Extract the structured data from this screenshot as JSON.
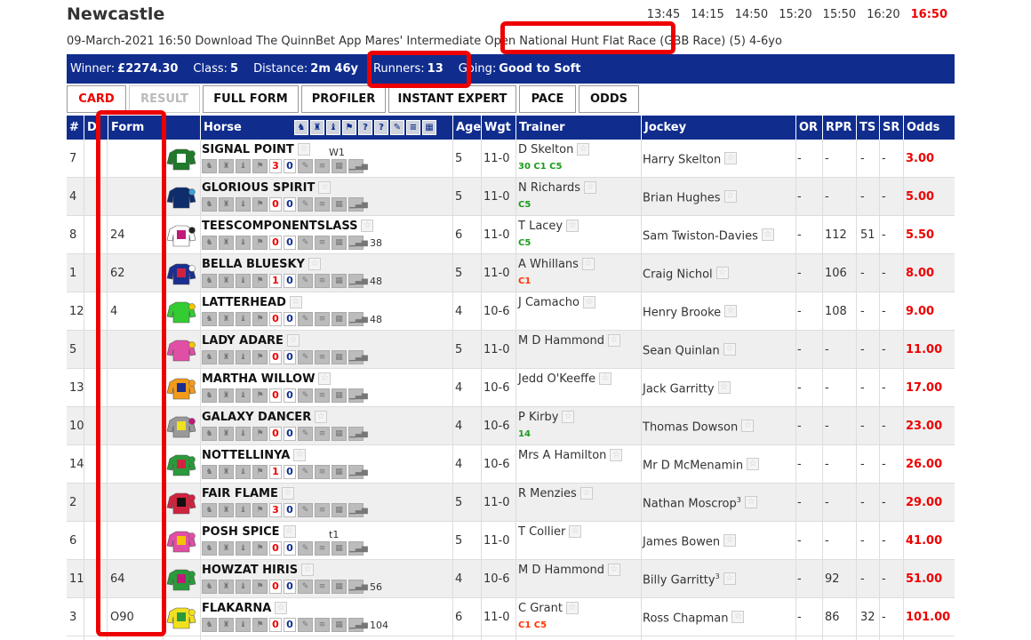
{
  "header": {
    "venue": "Newcastle",
    "times": [
      "13:45",
      "14:15",
      "14:50",
      "15:20",
      "15:50",
      "16:20",
      "16:50"
    ],
    "current_time": "16:50",
    "description": "09-March-2021 16:50 Download The QuinnBet App Mares' Intermediate Open National Hunt Flat Race (GBB Race) (5) 4-6yo"
  },
  "info": {
    "winner_label": "Winner:",
    "winner": "£2274.30",
    "class_label": "Class:",
    "class": "5",
    "distance_label": "Distance:",
    "distance": "2m 46y",
    "runners_label": "Runners:",
    "runners": "13",
    "going_label": "Going:",
    "going": "Good to Soft"
  },
  "tabs": [
    "CARD",
    "RESULT",
    "FULL FORM",
    "PROFILER",
    "INSTANT EXPERT",
    "PACE",
    "ODDS"
  ],
  "columns": {
    "num": "#",
    "draw": "D",
    "form": "Form",
    "horse": "Horse",
    "age": "Age",
    "wgt": "Wgt",
    "trainer": "Trainer",
    "jockey": "Jockey",
    "or": "OR",
    "rpr": "RPR",
    "ts": "TS",
    "sr": "SR",
    "odds": "Odds"
  },
  "header_icon_q": "?",
  "colors": {
    "bar": "#102d8e",
    "highlight": "#e00000",
    "odds": "#e00000"
  },
  "runners": [
    {
      "num": "7",
      "form": "",
      "horse": "SIGNAL POINT",
      "note": "W1",
      "b1": "3",
      "b2": "0",
      "rating": "",
      "age": "5",
      "wgt": "11-0",
      "trainer": "D Skelton",
      "tstat": "30 C1 C5",
      "tcolor": "green",
      "jockey": "Harry Skelton",
      "jsup": "",
      "or": "-",
      "rpr": "-",
      "ts": "-",
      "sr": "-",
      "odds": "3.00",
      "silk": [
        "#1f7a2a",
        "#ffffff",
        "#1f7a2a"
      ]
    },
    {
      "num": "4",
      "form": "",
      "horse": "GLORIOUS SPIRIT",
      "note": "",
      "b1": "0",
      "b2": "0",
      "rating": "",
      "age": "5",
      "wgt": "11-0",
      "trainer": "N Richards",
      "tstat": "C5",
      "tcolor": "green",
      "jockey": "Brian Hughes",
      "jsup": "",
      "or": "-",
      "rpr": "-",
      "ts": "-",
      "sr": "-",
      "odds": "5.00",
      "silk": [
        "#0d2d6b",
        "#0d2d6b",
        "#3aa0d8"
      ]
    },
    {
      "num": "8",
      "form": "24",
      "horse": "TEESCOMPONENTSLASS",
      "note": "",
      "b1": "0",
      "b2": "0",
      "rating": "38",
      "age": "6",
      "wgt": "11-0",
      "trainer": "T Lacey",
      "tstat": "C5",
      "tcolor": "green",
      "jockey": "Sam Twiston-Davies",
      "jsup": "",
      "or": "-",
      "rpr": "112",
      "ts": "51",
      "sr": "-",
      "odds": "5.50",
      "silk": [
        "#ffffff",
        "#c2187a",
        "#222222"
      ]
    },
    {
      "num": "1",
      "form": "62",
      "horse": "BELLA BLUESKY",
      "note": "",
      "b1": "1",
      "b2": "0",
      "rating": "48",
      "age": "5",
      "wgt": "11-0",
      "trainer": "A Whillans",
      "tstat": "C1",
      "tcolor": "red",
      "jockey": "Craig Nichol",
      "jsup": "",
      "or": "-",
      "rpr": "106",
      "ts": "-",
      "sr": "-",
      "odds": "8.00",
      "silk": [
        "#1a2f8f",
        "#d0233f",
        "#ffffff"
      ]
    },
    {
      "num": "12",
      "form": "4",
      "horse": "LATTERHEAD",
      "note": "",
      "b1": "0",
      "b2": "0",
      "rating": "48",
      "age": "4",
      "wgt": "10-6",
      "trainer": "J Camacho",
      "tstat": "",
      "tcolor": "green",
      "jockey": "Henry Brooke",
      "jsup": "",
      "or": "-",
      "rpr": "108",
      "ts": "-",
      "sr": "-",
      "odds": "9.00",
      "silk": [
        "#33cc33",
        "#33cc33",
        "#f2c500"
      ]
    },
    {
      "num": "5",
      "form": "",
      "horse": "LADY ADARE",
      "note": "",
      "b1": "0",
      "b2": "0",
      "rating": "",
      "age": "5",
      "wgt": "11-0",
      "trainer": "M D Hammond",
      "tstat": "",
      "tcolor": "green",
      "jockey": "Sean Quinlan",
      "jsup": "",
      "or": "-",
      "rpr": "-",
      "ts": "-",
      "sr": "-",
      "odds": "11.00",
      "silk": [
        "#e04fa5",
        "#e04fa5",
        "#f5c400"
      ]
    },
    {
      "num": "13",
      "form": "",
      "horse": "MARTHA WILLOW",
      "note": "",
      "b1": "0",
      "b2": "0",
      "rating": "",
      "age": "4",
      "wgt": "10-6",
      "trainer": "Jedd O'Keeffe",
      "tstat": "",
      "tcolor": "green",
      "jockey": "Jack Garritty",
      "jsup": "",
      "or": "-",
      "rpr": "-",
      "ts": "-",
      "sr": "-",
      "odds": "17.00",
      "silk": [
        "#f29a1a",
        "#1a2f8f",
        "#f29a1a"
      ]
    },
    {
      "num": "10",
      "form": "",
      "horse": "GALAXY DANCER",
      "note": "",
      "b1": "0",
      "b2": "0",
      "rating": "",
      "age": "4",
      "wgt": "10-6",
      "trainer": "P Kirby",
      "tstat": "14",
      "tcolor": "green",
      "jockey": "Thomas Dowson",
      "jsup": "",
      "or": "-",
      "rpr": "-",
      "ts": "-",
      "sr": "-",
      "odds": "23.00",
      "silk": [
        "#999999",
        "#f0e020",
        "#c2187a"
      ]
    },
    {
      "num": "14",
      "form": "",
      "horse": "NOTTELLINYA",
      "note": "",
      "b1": "1",
      "b2": "0",
      "rating": "",
      "age": "4",
      "wgt": "10-6",
      "trainer": "Mrs A Hamilton",
      "tstat": "",
      "tcolor": "green",
      "jockey": "Mr D McMenamin",
      "jsup": "",
      "or": "-",
      "rpr": "-",
      "ts": "-",
      "sr": "-",
      "odds": "26.00",
      "silk": [
        "#2a9a3a",
        "#d0233f",
        "#2a9a3a"
      ]
    },
    {
      "num": "2",
      "form": "",
      "horse": "FAIR FLAME",
      "note": "",
      "b1": "3",
      "b2": "0",
      "rating": "",
      "age": "5",
      "wgt": "11-0",
      "trainer": "R Menzies",
      "tstat": "",
      "tcolor": "green",
      "jockey": "Nathan Moscrop",
      "jsup": "3",
      "or": "-",
      "rpr": "-",
      "ts": "-",
      "sr": "-",
      "odds": "29.00",
      "silk": [
        "#d0233f",
        "#111111",
        "#d0233f"
      ]
    },
    {
      "num": "6",
      "form": "",
      "horse": "POSH SPICE",
      "note": "t1",
      "b1": "0",
      "b2": "0",
      "rating": "",
      "age": "5",
      "wgt": "11-0",
      "trainer": "T Collier",
      "tstat": "",
      "tcolor": "green",
      "jockey": "James Bowen",
      "jsup": "",
      "or": "-",
      "rpr": "-",
      "ts": "-",
      "sr": "-",
      "odds": "41.00",
      "silk": [
        "#e04fa5",
        "#f5c400",
        "#e04fa5"
      ]
    },
    {
      "num": "11",
      "form": "64",
      "horse": "HOWZAT HIRIS",
      "note": "",
      "b1": "0",
      "b2": "0",
      "rating": "56",
      "age": "4",
      "wgt": "10-6",
      "trainer": "M D Hammond",
      "tstat": "",
      "tcolor": "green",
      "jockey": "Billy Garritty",
      "jsup": "3",
      "or": "-",
      "rpr": "92",
      "ts": "-",
      "sr": "-",
      "odds": "51.00",
      "silk": [
        "#2a9a3a",
        "#c2187a",
        "#2a9a3a"
      ]
    },
    {
      "num": "3",
      "form": "O90",
      "horse": "FLAKARNA",
      "note": "",
      "b1": "0",
      "b2": "0",
      "rating": "104",
      "age": "6",
      "wgt": "11-0",
      "trainer": "C Grant",
      "tstat": "C1 C5",
      "tcolor": "red",
      "jockey": "Ross Chapman",
      "jsup": "",
      "or": "-",
      "rpr": "86",
      "ts": "32",
      "sr": "-",
      "odds": "101.00",
      "silk": [
        "#f0e020",
        "#2a9a3a",
        "#f0e020"
      ]
    }
  ]
}
